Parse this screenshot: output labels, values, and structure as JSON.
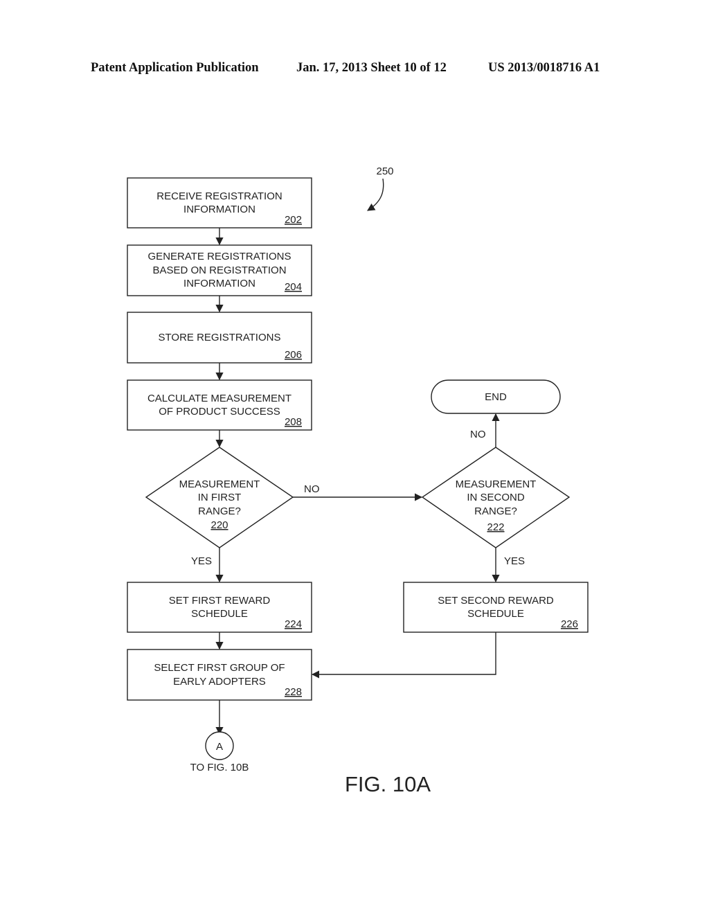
{
  "header": {
    "left": "Patent Application Publication",
    "middle": "Jan. 17, 2013  Sheet 10 of 12",
    "right": "US 2013/0018716 A1"
  },
  "diagram": {
    "reference": "250",
    "figure_label": "FIG. 10A",
    "nodes": {
      "n202": {
        "lines": [
          "RECEIVE REGISTRATION",
          "INFORMATION"
        ],
        "ref": "202"
      },
      "n204": {
        "lines": [
          "GENERATE REGISTRATIONS",
          "BASED ON REGISTRATION",
          "INFORMATION"
        ],
        "ref": "204"
      },
      "n206": {
        "lines": [
          "STORE REGISTRATIONS"
        ],
        "ref": "206"
      },
      "n208": {
        "lines": [
          "CALCULATE MEASUREMENT",
          "OF PRODUCT SUCCESS"
        ],
        "ref": "208"
      },
      "n220": {
        "lines": [
          "MEASUREMENT",
          "IN FIRST",
          "RANGE?"
        ],
        "ref": "220"
      },
      "n222": {
        "lines": [
          "MEASUREMENT",
          "IN SECOND",
          "RANGE?"
        ],
        "ref": "222"
      },
      "end": {
        "lines": [
          "END"
        ]
      },
      "n224": {
        "lines": [
          "SET FIRST REWARD",
          "SCHEDULE"
        ],
        "ref": "224"
      },
      "n226": {
        "lines": [
          "SET SECOND REWARD",
          "SCHEDULE"
        ],
        "ref": "226"
      },
      "n228": {
        "lines": [
          "SELECT FIRST GROUP OF",
          "EARLY ADOPTERS"
        ],
        "ref": "228"
      },
      "connector": {
        "label": "A",
        "caption": "TO FIG. 10B"
      }
    },
    "edges": {
      "n220_no": "NO",
      "n220_yes": "YES",
      "n222_no": "NO",
      "n222_yes": "YES"
    }
  }
}
